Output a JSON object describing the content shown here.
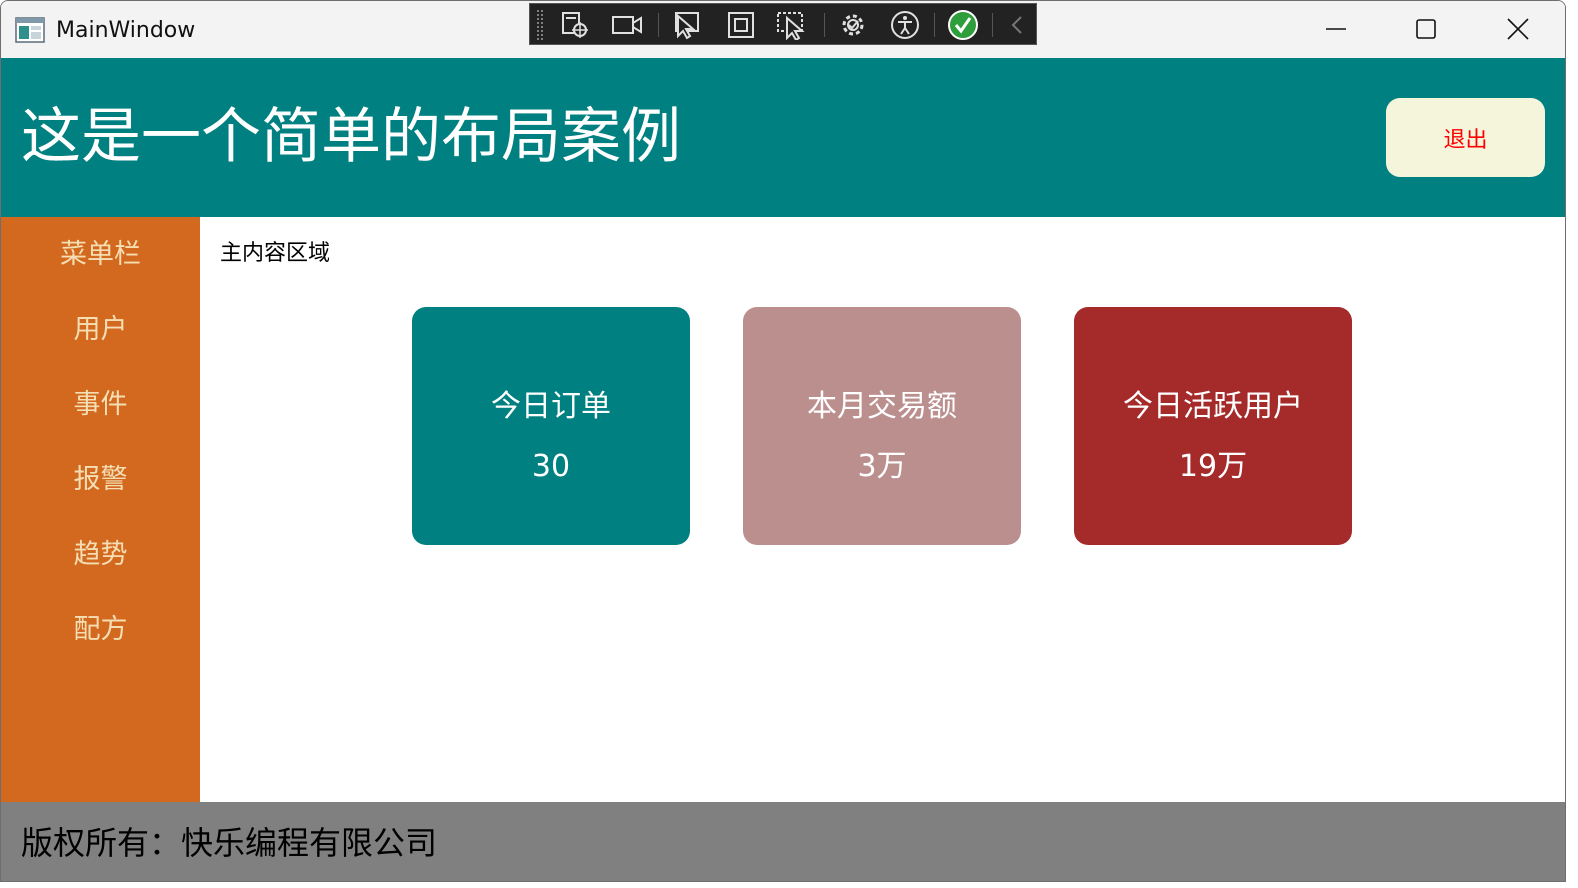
{
  "window": {
    "title": "MainWindow"
  },
  "header": {
    "title": "这是一个简单的布局案例",
    "logout_label": "退出"
  },
  "sidebar": {
    "items": [
      {
        "label": "菜单栏"
      },
      {
        "label": "用户"
      },
      {
        "label": "事件"
      },
      {
        "label": "报警"
      },
      {
        "label": "趋势"
      },
      {
        "label": "配方"
      }
    ]
  },
  "main": {
    "label": "主内容区域",
    "cards": [
      {
        "label": "今日订单",
        "value": "30",
        "color": "#008080"
      },
      {
        "label": "本月交易额",
        "value": "3万",
        "color": "#bc8f8f"
      },
      {
        "label": "今日活跃用户",
        "value": "19万",
        "color": "#a52a2a"
      }
    ]
  },
  "footer": {
    "text": "版权所有：快乐编程有限公司"
  },
  "colors": {
    "header_bg": "#008080",
    "sidebar_bg": "#d2691e",
    "sidebar_text": "#f5deb3",
    "logout_bg": "#f5f5dc",
    "logout_text": "#ff0000",
    "footer_bg": "#808080"
  },
  "devtools_toolbar": {
    "icons": [
      "select-element-icon",
      "record-icon",
      "pointer-icon",
      "bounds-icon",
      "track-focus-icon",
      "settings-gear-icon",
      "accessibility-icon",
      "check-icon",
      "collapse-chevron-icon"
    ]
  }
}
